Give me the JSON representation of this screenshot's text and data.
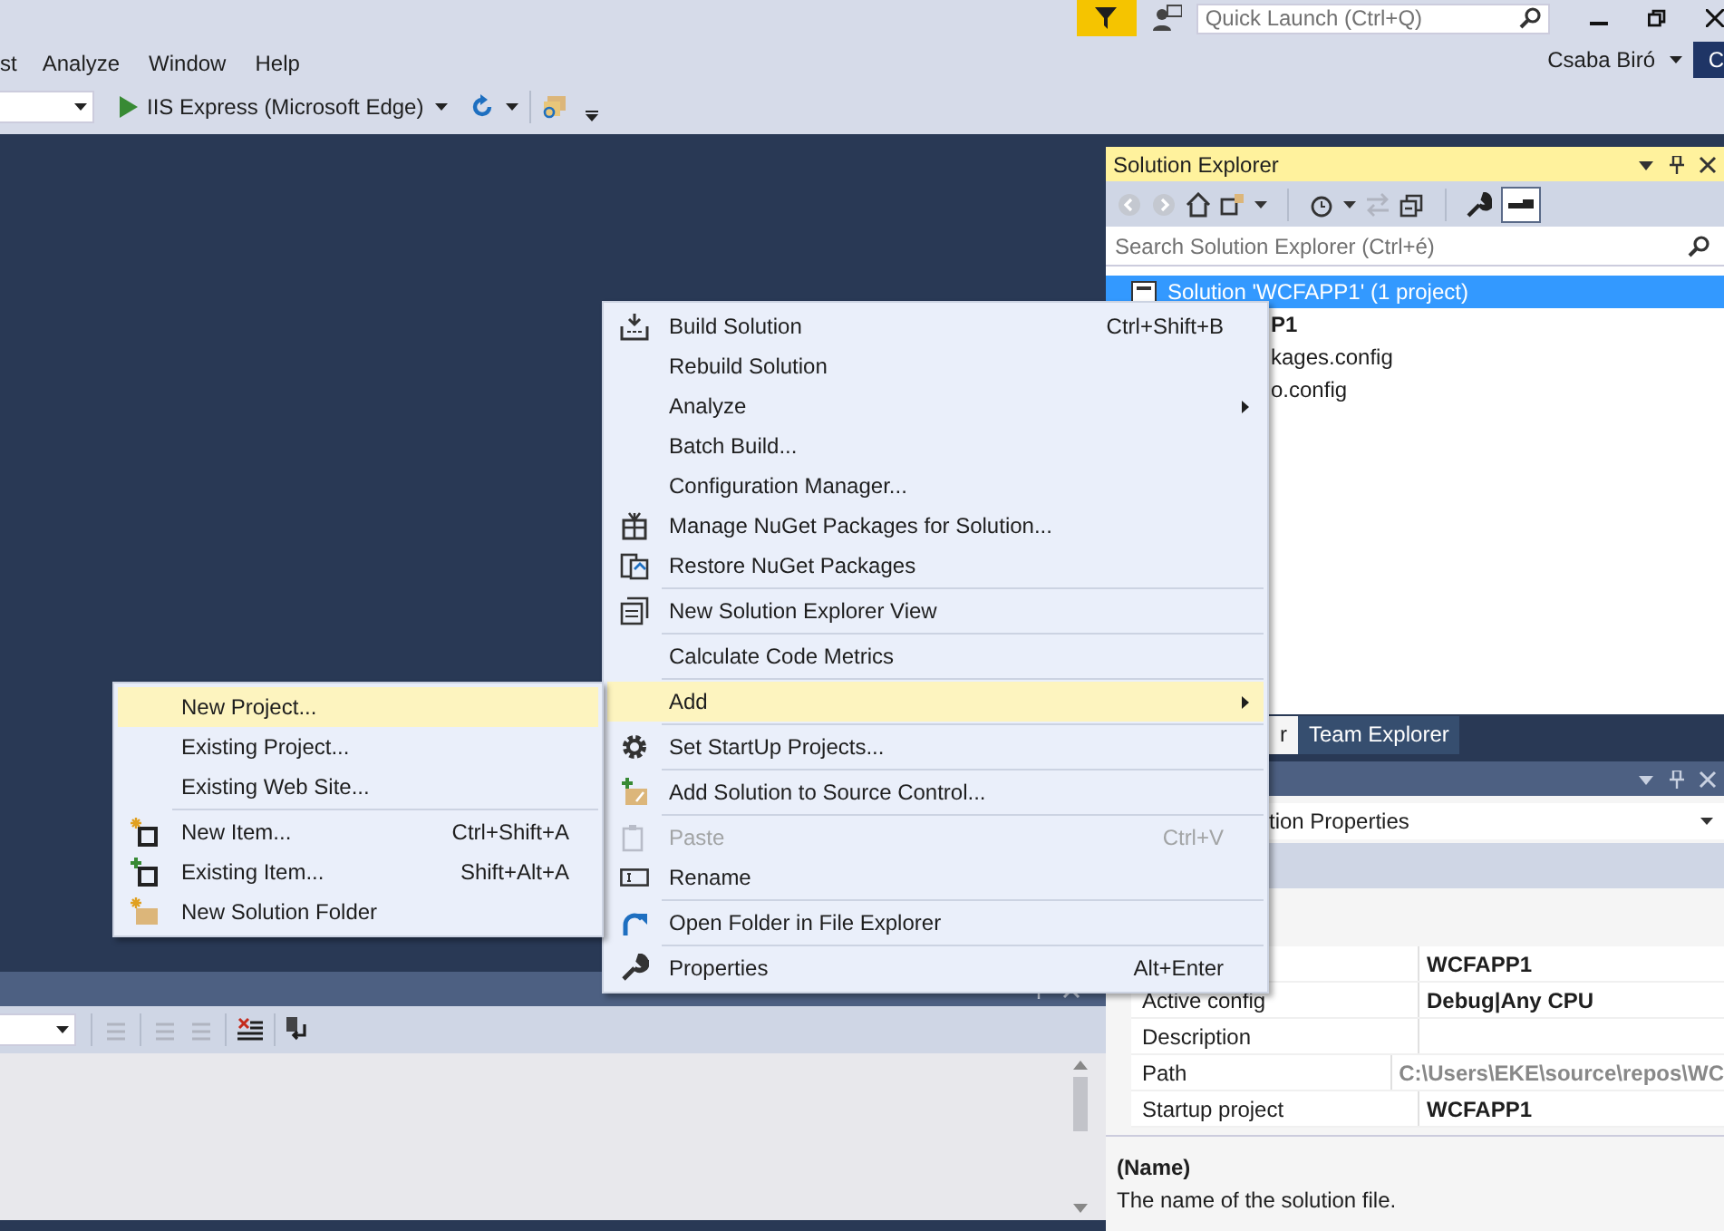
{
  "title_bar": {
    "quick_launch": {
      "placeholder": "Quick Launch (Ctrl+Q)"
    }
  },
  "menu_bar": {
    "items": [
      "st",
      "Analyze",
      "Window",
      "Help"
    ],
    "user": "Csaba Biró",
    "avatar": "C"
  },
  "toolbar": {
    "run_target": "IIS Express (Microsoft Edge)"
  },
  "solution_explorer": {
    "title": "Solution Explorer",
    "search": {
      "placeholder": "Search Solution Explorer (Ctrl+é)"
    },
    "tree": [
      {
        "text": "Solution 'WCFAPP1' (1 project)",
        "selected": true,
        "bold": false,
        "children": [
          {
            "text": "P1",
            "selected": false,
            "bold": true,
            "children": [
              {
                "text": "kages.config",
                "selected": false,
                "bold": false
              },
              {
                "text": "o.config",
                "selected": false,
                "bold": false
              }
            ]
          }
        ]
      }
    ]
  },
  "tabs": [
    {
      "label": "r",
      "selected": true
    },
    {
      "label": "Team Explorer",
      "selected": false
    }
  ],
  "properties": {
    "object": "tion Properties",
    "rows": [
      {
        "value": "WCFAPP1",
        "bold": true,
        "disabled": false
      },
      {
        "name": "Active config",
        "value": "Debug|Any CPU",
        "bold": true,
        "disabled": false
      },
      {
        "name": "Description"
      },
      {
        "name": "Path",
        "value": "C:\\Users\\EKE\\source\\repos\\WC",
        "bold": true,
        "disabled": true
      },
      {
        "name": "Startup project",
        "value": "WCFAPP1",
        "bold": true,
        "disabled": false
      }
    ],
    "description": {
      "title": "(Name)",
      "text": "The name of the solution file."
    }
  },
  "context_menu": {
    "groups": [
      [
        {
          "label": "Build Solution",
          "shortcut": "Ctrl+Shift+B",
          "submenu": false,
          "disabled": false,
          "selected": false
        },
        {
          "label": "Rebuild Solution",
          "submenu": false,
          "disabled": false,
          "selected": false
        },
        {
          "label": "Analyze",
          "submenu": true,
          "disabled": false,
          "selected": false
        },
        {
          "label": "Batch Build...",
          "submenu": false,
          "disabled": false,
          "selected": false
        },
        {
          "label": "Configuration Manager...",
          "submenu": false,
          "disabled": false,
          "selected": false
        },
        {
          "label": "Manage NuGet Packages for Solution...",
          "submenu": false,
          "disabled": false,
          "selected": false
        },
        {
          "label": "Restore NuGet Packages",
          "submenu": false,
          "disabled": false,
          "selected": false
        }
      ],
      [
        {
          "label": "New Solution Explorer View",
          "submenu": false,
          "disabled": false,
          "selected": false
        }
      ],
      [
        {
          "label": "Calculate Code Metrics",
          "submenu": false,
          "disabled": false,
          "selected": false
        }
      ],
      [
        {
          "label": "Add",
          "submenu": true,
          "disabled": false,
          "selected": true
        }
      ],
      [
        {
          "label": "Set StartUp Projects...",
          "submenu": false,
          "disabled": false,
          "selected": false
        }
      ],
      [
        {
          "label": "Add Solution to Source Control...",
          "submenu": false,
          "disabled": false,
          "selected": false
        }
      ],
      [
        {
          "label": "Paste",
          "shortcut": "Ctrl+V",
          "submenu": false,
          "disabled": true,
          "selected": false
        },
        {
          "label": "Rename",
          "submenu": false,
          "disabled": false,
          "selected": false
        }
      ],
      [
        {
          "label": "Open Folder in File Explorer",
          "submenu": false,
          "disabled": false,
          "selected": false
        }
      ],
      [
        {
          "label": "Properties",
          "shortcut": "Alt+Enter",
          "submenu": false,
          "disabled": false,
          "selected": false
        }
      ]
    ]
  },
  "add_submenu": {
    "groups": [
      [
        {
          "label": "New Project...",
          "selected": true,
          "disabled": false
        },
        {
          "label": "Existing Project...",
          "selected": false,
          "disabled": false
        },
        {
          "label": "Existing Web Site...",
          "selected": false,
          "disabled": false
        }
      ],
      [
        {
          "label": "New Item...",
          "shortcut": "Ctrl+Shift+A",
          "selected": false,
          "disabled": false
        },
        {
          "label": "Existing Item...",
          "shortcut": "Shift+Alt+A",
          "selected": false,
          "disabled": false
        },
        {
          "label": "New Solution Folder",
          "selected": false,
          "disabled": false
        }
      ]
    ]
  }
}
